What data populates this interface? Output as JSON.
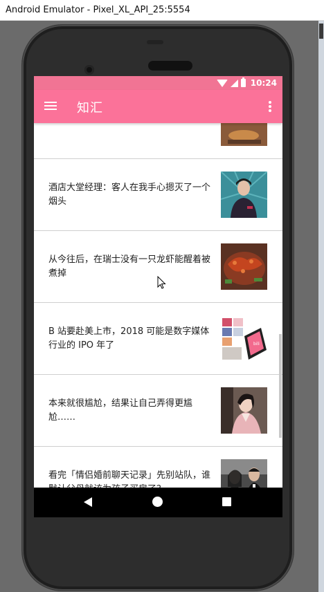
{
  "window": {
    "title": "Android Emulator - Pixel_XL_API_25:5554"
  },
  "statusbar": {
    "time": "10:24"
  },
  "appbar": {
    "title": "知汇"
  },
  "colors": {
    "primary": "#fb7299",
    "statusbar": "#f17494"
  },
  "icons": {
    "menu": "hamburger-menu-icon",
    "overflow": "more-vertical-icon",
    "wifi": "wifi-icon",
    "signal": "cell-signal-icon",
    "battery": "battery-icon",
    "back": "nav-back-icon",
    "home": "nav-home-icon",
    "recent": "nav-recent-apps-icon"
  },
  "feed": {
    "items": [
      {
        "title": ""
      },
      {
        "title": "酒店大堂经理：客人在我手心摁灭了一个烟头"
      },
      {
        "title": "从今往后，在瑞士没有一只龙虾能醒着被煮掉"
      },
      {
        "title": "B 站要赴美上市，2018 可能是数字媒体行业的 IPO 年了"
      },
      {
        "title": "本来就很尴尬，结果让自己弄得更尴尬……"
      },
      {
        "title": "看完「情侣婚前聊天记录」先别站队，谁默认父母就该为孩子买房了？"
      }
    ]
  }
}
